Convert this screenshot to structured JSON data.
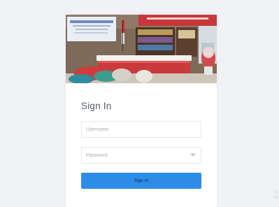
{
  "login": {
    "title": "Sign In",
    "username_placeholder": "Username",
    "password_placeholder": "Password",
    "submit_label": "Sign In"
  },
  "watermark": {
    "line1": "A",
    "line2": "G"
  },
  "colors": {
    "primary": "#2d8ce8",
    "background": "#f1f2f6"
  },
  "icons": {
    "password_toggle": "eye-icon"
  }
}
